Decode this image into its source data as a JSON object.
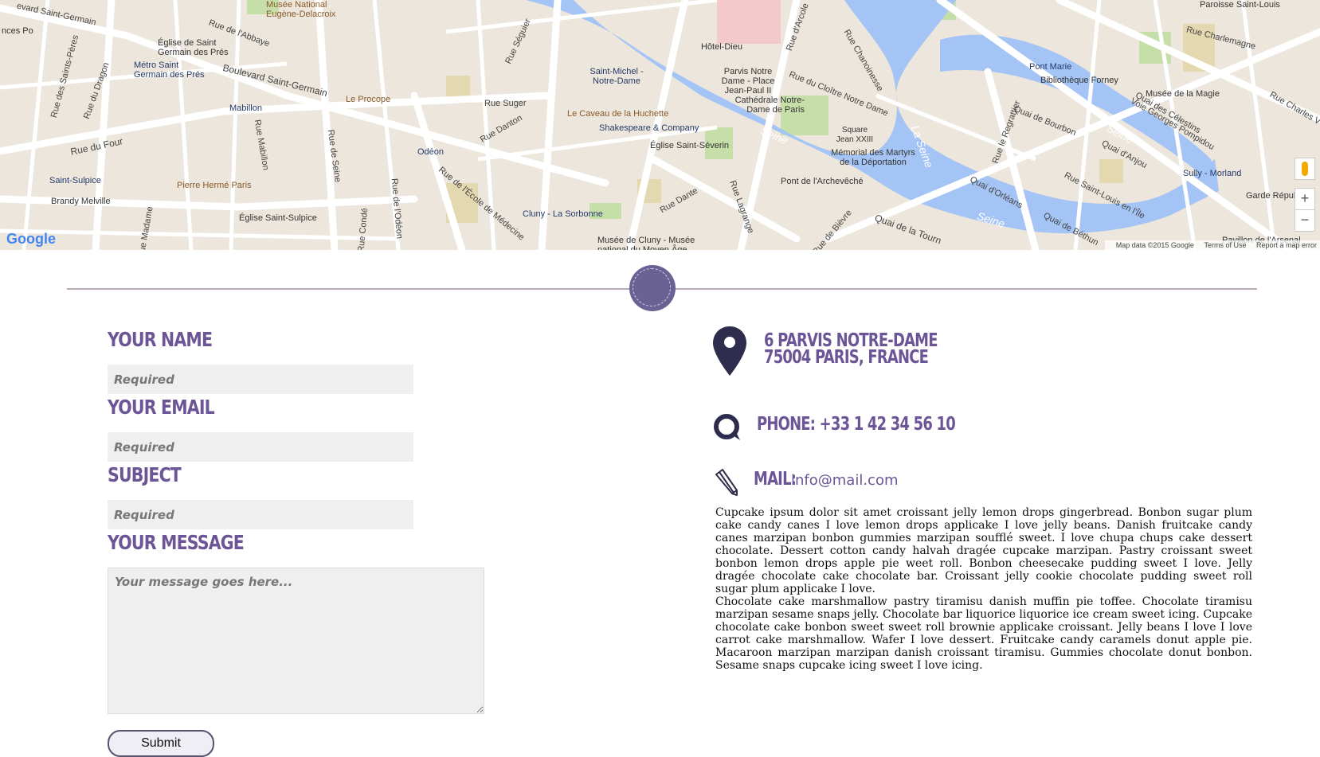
{
  "map": {
    "labels": [
      "evard Saint-Germain",
      "Musée National Eugène-Delacroix",
      "nces Po",
      "Église de Saint Germain des Prés",
      "Métro Saint Germain des Prés",
      "Boulevard Saint-Germain",
      "Le Procope",
      "Mabillon",
      "Rue Suger",
      "Rue du Four",
      "Saint-Sulpice",
      "Pierre Hermé Paris",
      "Brandy Melville",
      "Église Saint-Sulpice",
      "Odéon",
      "Saint-Michel - Notre-Dame",
      "Le Caveau de la Huchette",
      "Shakespeare & Company",
      "Église Saint-Séverin",
      "Cluny - La Sorbonne",
      "Musée de Cluny - Musée national du Moyen Âge",
      "Hôtel-Dieu",
      "Parvis Notre Dame - Place Jean-Paul II",
      "Cathédrale Notre-Dame de Paris",
      "Square Jean XXIII",
      "Mémorial des Martyrs de la Déportation",
      "Pont de l'Archevêché",
      "Rue du Cloître Notre Dame",
      "Pont Marie",
      "Bibliothèque Forney",
      "Musée de la Magie",
      "Quai de Bourbon",
      "Quai d'Anjou",
      "Quai d'Orléans",
      "Rue Saint-Louis en l'Île",
      "Sully - Morland",
      "Quai de Béthun",
      "Garde Républ",
      "Rue Charlemagne",
      "Paroisse Saint-Louis",
      "Voie Georges Pompidou",
      "Quai des Célestins",
      "Rue Dante",
      "Rue Lagrange",
      "Rue de l'École de Médecine",
      "Rue Danton",
      "Rue Séguier",
      "Rue de l'Abbaye",
      "Rue du Dragon",
      "Rue des Saints-Pères",
      "Rue Mabillon",
      "Rue de Seine",
      "Rue de l'Odéon",
      "Rue Condé",
      "Rue Madame",
      "Rue Charles V",
      "Rue de Bièvre",
      "Quai de la Tourn",
      "Pavillon de l'Arsenal",
      "Rue le Regrattier",
      "Rue d'Arcole",
      "Rue Chanoinesse",
      "Seine",
      "Seine",
      "La Seine",
      "Seine"
    ],
    "footer_data": "Map data ©2015 Google",
    "footer_terms": "Terms of Use",
    "footer_report": "Report a map error",
    "google_logo": "Google",
    "zoom_in": "+",
    "zoom_out": "−",
    "colors": {
      "water": "#a4c4f5",
      "land": "#ece6dc",
      "road": "#ffffff",
      "park": "#c6dfa9"
    }
  },
  "form": {
    "name_label": "Your Name",
    "name_placeholder": "Required",
    "email_label": "Your Email",
    "email_placeholder": "Required",
    "subject_label": "Subject",
    "subject_placeholder": "Required",
    "message_label": "Your Message",
    "message_placeholder": "Your message goes here...",
    "submit_label": "Submit"
  },
  "contact": {
    "address_line1": "6 Parvis Notre-Dame",
    "address_line2": "75004 Paris, France",
    "phone": "Phone: +33 1 42 34 56 10",
    "mail_label": "Mail:",
    "mail_value": "info@mail.com",
    "paragraph1": "Cupcake ipsum dolor sit amet croissant jelly lemon drops gingerbread. Bonbon sugar plum cake candy canes I love lemon drops applicake I love jelly beans. Danish fruitcake candy canes marzipan bonbon gummies marzipan soufflé sweet. I love chupa chups cake dessert chocolate. Dessert cotton candy halvah dragée cupcake marzipan. Pastry croissant sweet bonbon lemon drops apple pie weet roll. Bonbon cheesecake pudding sweet I love. Jelly dragée chocolate cake chocolate bar. Croissant jelly cookie chocolate pudding sweet roll sugar plum applicake I love.",
    "paragraph2": "Chocolate cake marshmallow pastry tiramisu danish muffin pie toffee. Chocolate tiramisu marzipan sesame snaps jelly. Chocolate bar liquorice liquorice ice cream sweet icing. Cupcake chocolate cake bonbon sweet sweet roll brownie applicake croissant. Jelly beans I love I love carrot cake marshmallow. Wafer I love dessert. Fruitcake candy caramels donut apple pie. Macaroon marzipan marzipan danish croissant tiramisu. Gummies chocolate donut bonbon. Sesame snaps cupcake icing sweet I love icing."
  },
  "accent_color": "#6b5596"
}
